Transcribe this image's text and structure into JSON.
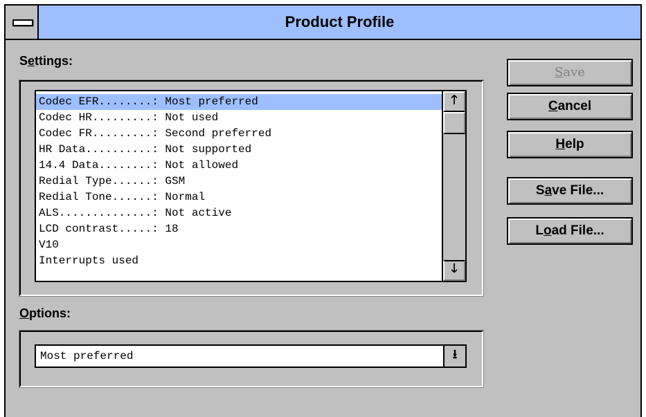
{
  "window": {
    "title": "Product Profile"
  },
  "settings": {
    "label_pre": "S",
    "label_ul": "e",
    "label_post": "ttings:",
    "rows": [
      "Codec EFR........: Most preferred",
      "Codec HR.........: Not used",
      "Codec FR.........: Second preferred",
      "HR Data..........: Not supported",
      "14.4 Data........: Not allowed",
      "Redial Type......: GSM",
      "Redial Tone......: Normal",
      "ALS..............: Not active",
      "LCD contrast.....: 18",
      "V10",
      "Interrupts used"
    ],
    "selected_index": 0,
    "scroll_up": "🡑",
    "scroll_down": "🡓"
  },
  "options": {
    "label_pre": "",
    "label_ul": "O",
    "label_post": "ptions:",
    "value": "Most preferred",
    "dropdown_glyph": "⭳"
  },
  "buttons": {
    "save": {
      "pre": "",
      "ul": "S",
      "post": "ave",
      "enabled": false
    },
    "cancel": {
      "pre": "",
      "ul": "C",
      "post": "ancel"
    },
    "help": {
      "pre": "",
      "ul": "H",
      "post": "elp"
    },
    "save_file": {
      "pre": "S",
      "ul": "a",
      "post": "ve File..."
    },
    "load_file": {
      "pre": "L",
      "ul": "o",
      "post": "ad File..."
    }
  },
  "colors": {
    "titlebar": "#9ebfff",
    "face": "#c0c0c0",
    "selection": "#9ebfff"
  }
}
